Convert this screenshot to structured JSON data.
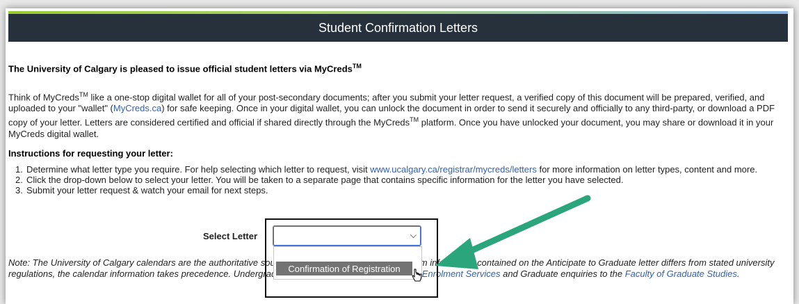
{
  "header": {
    "title": "Student Confirmation Letters",
    "accent_start": "#9acd32",
    "accent_end": "#86b7e6",
    "bar_color": "#26313b"
  },
  "intro": {
    "heading": "The University of Calgary is pleased to issue official student letters via MyCreds",
    "heading_sup": "TM",
    "p1": "Think of MyCreds",
    "p1_sup": "TM",
    "p2": " like a one-stop digital wallet for all of your post-secondary documents; after you submit your letter request, a verified copy of this document will be prepared, verified, and uploaded to your \"wallet\" (",
    "p2_link": "MyCreds.ca",
    "p3": ") for safe keeping. Once in your digital wallet, you can unlock the document in order to send it securely and officially to any third-party, or download a PDF copy of your letter. Letters are considered certified and official if shared directly through the MyCreds",
    "p3_sup": "TM",
    "p4": " platform. Once you have unlocked your document, you may share or download it in your MyCreds digital wallet."
  },
  "instructions": {
    "heading": "Instructions for requesting your letter:",
    "step1_num": "1.",
    "step1a": "Determine what letter type you require. For help selecting which letter to request, visit ",
    "step1_link": "www.ucalgary.ca/registrar/mycreds/letters",
    "step1b": " for more information on letter types, content and more.",
    "step2_num": "2.",
    "step2": "Click the drop-down below to select your letter. You will be taken to a separate page that contains specific information for the letter you have selected.",
    "step3_num": "3.",
    "step3": "Submit your letter request & watch your email for next steps."
  },
  "select": {
    "label": "Select Letter",
    "value": "",
    "option": "Confirmation of Registration"
  },
  "note": {
    "a": "Note: The University of Calgary calendars are the authoritative source of program information. If program information contained on the Anticipate to Graduate letter differs from stated university regulations, the calendar information takes precedence. Undergraduate enquiries should be directed to ",
    "link1": "Enrolment Services",
    "b": " and Graduate enquiries to the ",
    "link2": "Faculty of Graduate Studies",
    "c": "."
  },
  "annotation": {
    "arrow_color": "#2aa57c",
    "icon": "arrow-annotation-icon"
  }
}
